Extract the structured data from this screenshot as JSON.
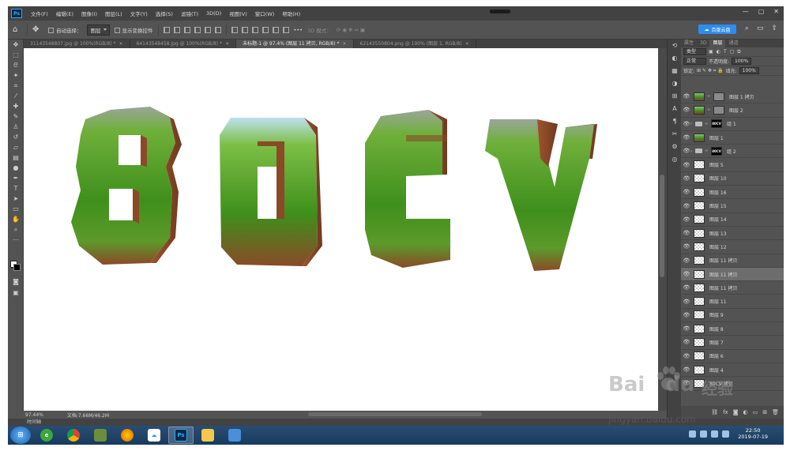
{
  "app": {
    "logo": "Ps",
    "menus": [
      "文件(F)",
      "编辑(E)",
      "图像(I)",
      "图层(L)",
      "文字(Y)",
      "选择(S)",
      "滤镜(T)",
      "3D(D)",
      "视图(V)",
      "窗口(W)",
      "帮助(H)"
    ],
    "window_controls": [
      "—",
      "▢",
      "✕"
    ]
  },
  "options": {
    "auto_select_label": "自动选择：",
    "auto_select_target": "图层",
    "show_transform_label": "显示变换控件",
    "mode_3d": "3D 模式：",
    "baidu_button": "百度云盘"
  },
  "tabs": [
    {
      "label": "31143548807.jpg @ 100%(RGB/8) *",
      "active": false
    },
    {
      "label": "64143548458.jpg @ 100%(RGB/8) *",
      "active": false
    },
    {
      "label": "未标题-1 @ 97.4% (图层 11 拷贝, RGB/8) *",
      "active": true
    },
    {
      "label": "62143550804.png @ 100% (图层 1, RGB/8)",
      "active": false
    }
  ],
  "canvas": {
    "letters": [
      "8",
      "0",
      "C",
      "V"
    ]
  },
  "status": {
    "zoom": "97.44%",
    "doc": "文档:7.66M/46.2M",
    "timeline": "时间轴"
  },
  "panel": {
    "tabs": [
      "属性",
      "3D",
      "图层",
      "通道"
    ],
    "active_tab": "图层",
    "kind_filter": "类型",
    "blend_mode": "正常",
    "opacity_label": "不透明度:",
    "opacity_value": "100%",
    "lock_label": "锁定:",
    "fill_label": "填充:",
    "fill_value": "100%",
    "layers": [
      {
        "name": "图层 1 拷贝",
        "thumb": "grass",
        "mask": true,
        "group": false,
        "selected": false
      },
      {
        "name": "图层 2",
        "thumb": "grass",
        "mask": true,
        "group": false,
        "selected": false
      },
      {
        "name": "组 1",
        "thumb": "mask",
        "mask_text": "80CV",
        "group": true,
        "selected": false
      },
      {
        "name": "图层 1",
        "thumb": "grass",
        "mask": false,
        "group": false,
        "selected": false
      },
      {
        "name": "组 2",
        "thumb": "mask",
        "mask_text": "80CV",
        "group": true,
        "selected": false
      },
      {
        "name": "图层 5",
        "thumb": "checker",
        "group": false,
        "selected": false
      },
      {
        "name": "图层 10",
        "thumb": "checker",
        "group": false,
        "selected": false
      },
      {
        "name": "图层 16",
        "thumb": "checker",
        "group": false,
        "selected": false
      },
      {
        "name": "图层 15",
        "thumb": "checker",
        "group": false,
        "selected": false
      },
      {
        "name": "图层 14",
        "thumb": "checker",
        "group": false,
        "selected": false
      },
      {
        "name": "图层 13",
        "thumb": "checker",
        "group": false,
        "selected": false
      },
      {
        "name": "图层 12",
        "thumb": "checker",
        "group": false,
        "selected": false
      },
      {
        "name": "图层 11 拷贝",
        "thumb": "checker",
        "group": false,
        "selected": false
      },
      {
        "name": "图层 11 拷贝",
        "thumb": "checker",
        "group": false,
        "selected": true
      },
      {
        "name": "图层 11 拷贝",
        "thumb": "checker",
        "group": false,
        "selected": false
      },
      {
        "name": "图层 11",
        "thumb": "checker",
        "group": false,
        "selected": false
      },
      {
        "name": "图层 9",
        "thumb": "checker",
        "group": false,
        "selected": false
      },
      {
        "name": "图层 8",
        "thumb": "checker",
        "group": false,
        "selected": false
      },
      {
        "name": "图层 7",
        "thumb": "checker",
        "group": false,
        "selected": false
      },
      {
        "name": "图层 6",
        "thumb": "checker",
        "group": false,
        "selected": false
      },
      {
        "name": "图层 4",
        "thumb": "checker",
        "group": false,
        "selected": false
      },
      {
        "name": "80CV 拷贝",
        "thumb": "checker",
        "group": false,
        "selected": false
      }
    ]
  },
  "taskbar": {
    "time": "22:50",
    "date": "2019-07-19"
  },
  "watermark": {
    "brand": "Bai",
    "brand2": "du",
    "jingyan": "经验",
    "url": "jingyan.baidu.com"
  },
  "colors": {
    "ps_blue": "#31a8ff",
    "grass_green": "#4f9b22",
    "earth_brown": "#8a4a28",
    "sky_blue": "#bfe0f0"
  }
}
